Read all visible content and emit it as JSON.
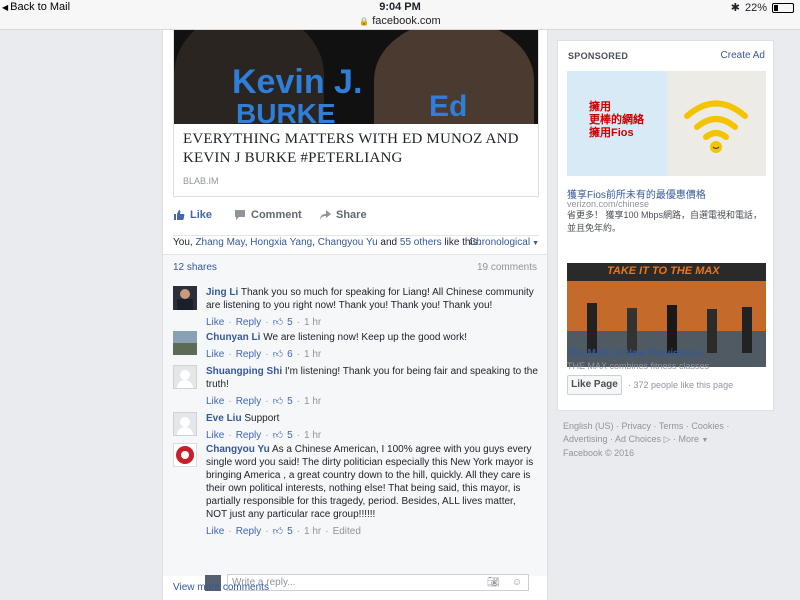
{
  "statusbar": {
    "back_label": "Back to Mail",
    "time": "9:04 PM",
    "url": "facebook.com",
    "battery": "22%",
    "battery_fraction": 0.22
  },
  "attachment": {
    "image_text_1": "Kevin J.",
    "image_text_2": "BURKE",
    "image_text_3": "Ed",
    "title": "EVERYTHING MATTERS WITH ED MUNOZ AND KEVIN J BURKE #PETERLIANG",
    "source": "BLAB.IM"
  },
  "actions": {
    "like": "Like",
    "comment": "Comment",
    "share": "Share"
  },
  "likers": {
    "prefix": "You,",
    "name1": "Zhang May",
    "name2": "Hongxia Yang",
    "name3": "Changyou Yu",
    "and": "and",
    "others": "55 others",
    "suffix": "like this.",
    "sort": "Chronological"
  },
  "counts": {
    "shares": "12 shares",
    "comments": "19 comments"
  },
  "comments": [
    {
      "name": "Jing Li",
      "text": "Thank you so much for speaking for Liang! All Chinese community are listening to you right now! Thank you! Thank you! Thank you!",
      "like": "Like",
      "reply": "Reply",
      "likes": "5",
      "time": "1 hr",
      "edited": ""
    },
    {
      "name": "Chunyan Li",
      "text": "We are listening now! Keep up the good work!",
      "like": "Like",
      "reply": "Reply",
      "likes": "6",
      "time": "1 hr",
      "edited": ""
    },
    {
      "name": "Shuangping Shi",
      "text": "I'm listening! Thank you for being fair and speaking to the truth!",
      "like": "Like",
      "reply": "Reply",
      "likes": "5",
      "time": "1 hr",
      "edited": ""
    },
    {
      "name": "Eve Liu",
      "text": "Support",
      "like": "Like",
      "reply": "Reply",
      "likes": "5",
      "time": "1 hr",
      "edited": ""
    },
    {
      "name": "Changyou Yu",
      "text": "As a Chinese American, I 100% agree with you guys every single word you said! The dirty politician especially this New York mayor is bringing America , a great country down to the hill, quickly. All they care is their own political interests, nothing else! That being said, this mayor, is partially responsible for this tragedy, period. Besides, ALL lives matter, NOT just any particular race group!!!!!!",
      "like": "Like",
      "reply": "Reply",
      "likes": "5",
      "time": "1 hr",
      "edited": "Edited"
    }
  ],
  "reply_placeholder": "Write a reply...",
  "view_more": "View more comments",
  "sponsored": {
    "header": "SPONSORED",
    "create_ad": "Create Ad",
    "ad1": {
      "image_line1": "擁用",
      "image_line2": "更棒的網絡",
      "image_line3": "擁用Fios",
      "title": "獲享Fios前所未有的最優惠價格",
      "domain": "verizon.com/chinese",
      "desc": "省更多！ 獲享100 Mbps網路，自選電視和電話，並且免年約。"
    },
    "ad2": {
      "image_text": "TAKE IT TO THE MAX",
      "title": "The MAX of New Providence",
      "subtitle": "THE MAX combines fitness classes",
      "like_button": "Like Page",
      "likes": "372 people like this page"
    }
  },
  "footer": {
    "line1": "English (US) · Privacy · Terms · Cookies ·",
    "line2_a": "Advertising · Ad Choices",
    "line2_b": "· More",
    "line3": "Facebook © 2016"
  },
  "colors": {
    "fb_blue": "#365899",
    "like_blue": "#4267b2",
    "page_bg": "#e9ebee"
  }
}
